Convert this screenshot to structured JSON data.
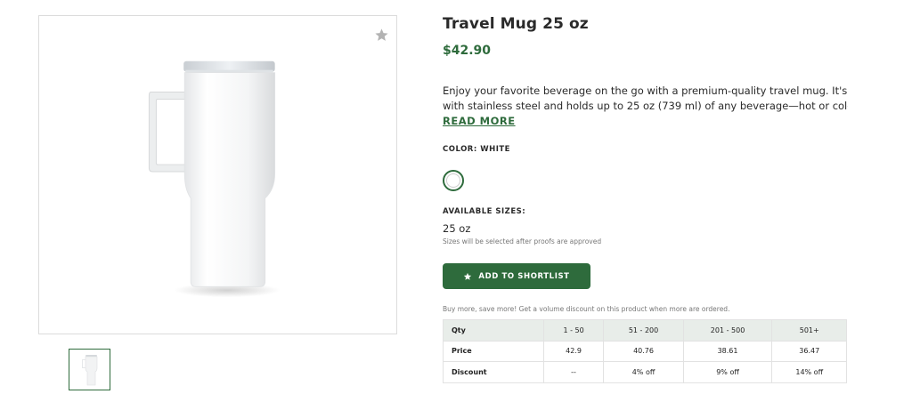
{
  "product": {
    "title": "Travel Mug 25 oz",
    "price": "$42.90",
    "description_line1": "Enjoy your favorite beverage on the go with a premium-quality travel mug. It's made",
    "description_line2": "with stainless steel and holds up to 25 oz (739 ml) of any beverage—hot or cold. It fi…",
    "read_more": "READ MORE",
    "color_label": "COLOR: WHITE",
    "colors": [
      {
        "name": "White",
        "hex": "#ffffff",
        "selected": true
      }
    ],
    "sizes_label": "AVAILABLE SIZES:",
    "size_value": "25 oz",
    "size_note": "Sizes will be selected after proofs are approved",
    "button_label": "ADD TO SHORTLIST",
    "button_icon": "star-icon",
    "favorite_icon": "star-icon"
  },
  "pricing": {
    "note": "Buy more, save more! Get a volume discount on this product when more are ordered.",
    "header": [
      "Qty",
      "1 - 50",
      "51 - 200",
      "201 - 500",
      "501+"
    ],
    "rows": [
      [
        "Price",
        "42.9",
        "40.76",
        "38.61",
        "36.47"
      ],
      [
        "Discount",
        "--",
        "4% off",
        "9% off",
        "14% off"
      ]
    ]
  },
  "colors": {
    "accent": "#2e6b3c",
    "table_header_bg": "#e8ede9"
  }
}
